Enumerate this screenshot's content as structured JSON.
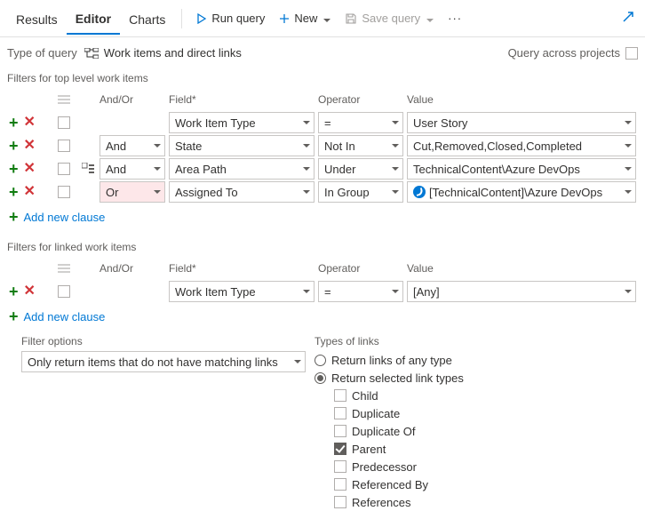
{
  "tabs": {
    "results": "Results",
    "editor": "Editor",
    "charts": "Charts"
  },
  "toolbar": {
    "run": "Run query",
    "new": "New",
    "save": "Save query",
    "more": "···"
  },
  "meta": {
    "type_label": "Type of query",
    "type_value": "Work items and direct links",
    "across_label": "Query across projects"
  },
  "sections": {
    "top": "Filters for top level work items",
    "linked": "Filters for linked work items"
  },
  "headers": {
    "andor": "And/Or",
    "field": "Field*",
    "operator": "Operator",
    "value": "Value"
  },
  "top_rows": [
    {
      "andor": "",
      "field": "Work Item Type",
      "op": "=",
      "value": "User Story",
      "group": false,
      "highlight": false
    },
    {
      "andor": "And",
      "field": "State",
      "op": "Not In",
      "value": "Cut,Removed,Closed,Completed",
      "group": false,
      "highlight": false
    },
    {
      "andor": "And",
      "field": "Area Path",
      "op": "Under",
      "value": "TechnicalContent\\Azure DevOps",
      "group": true,
      "highlight": false
    },
    {
      "andor": "Or",
      "field": "Assigned To",
      "op": "In Group",
      "value": "[TechnicalContent]\\Azure DevOps",
      "group": false,
      "highlight": true,
      "value_icon": true
    }
  ],
  "linked_rows": [
    {
      "andor": "",
      "field": "Work Item Type",
      "op": "=",
      "value": "[Any]"
    }
  ],
  "add_clause": "Add new clause",
  "filter_options": {
    "label": "Filter options",
    "value": "Only return items that do not have matching links"
  },
  "types_of_links": {
    "label": "Types of links",
    "radio_any": "Return links of any type",
    "radio_selected": "Return selected link types",
    "selected": "selected",
    "items": [
      {
        "label": "Child",
        "checked": false
      },
      {
        "label": "Duplicate",
        "checked": false
      },
      {
        "label": "Duplicate Of",
        "checked": false
      },
      {
        "label": "Parent",
        "checked": true
      },
      {
        "label": "Predecessor",
        "checked": false
      },
      {
        "label": "Referenced By",
        "checked": false
      },
      {
        "label": "References",
        "checked": false
      }
    ]
  }
}
